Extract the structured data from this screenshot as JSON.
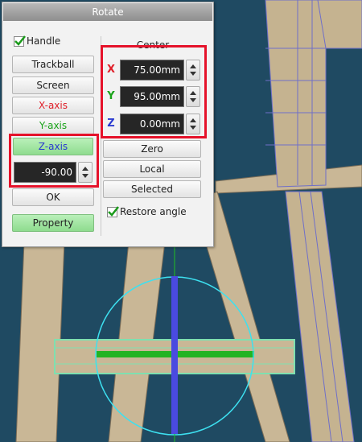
{
  "dialog": {
    "title": "Rotate",
    "handle_label": "Handle",
    "handle_checked": true,
    "center_title": "Center",
    "buttons": {
      "trackball": "Trackball",
      "screen": "Screen",
      "x_axis": "X-axis",
      "y_axis": "Y-axis",
      "z_axis": "Z-axis",
      "ok": "OK",
      "property": "Property",
      "zero": "Zero",
      "local": "Local",
      "selected": "Selected"
    },
    "angle_value": "-90.00",
    "center": {
      "x_label": "X",
      "x_value": "75.00mm",
      "y_label": "Y",
      "y_value": "95.00mm",
      "z_label": "Z",
      "z_value": "0.00mm"
    },
    "restore_angle_label": "Restore angle",
    "restore_angle_checked": true
  },
  "colors": {
    "x_axis": "#e0202a",
    "y_axis": "#1aa31a",
    "z_axis": "#2a3ad0",
    "highlight": "#e5122a",
    "viewport_bg": "#1f4a62"
  },
  "icons": {
    "check": "checkmark-icon",
    "spin_up": "triangle-up-icon",
    "spin_down": "triangle-down-icon"
  }
}
